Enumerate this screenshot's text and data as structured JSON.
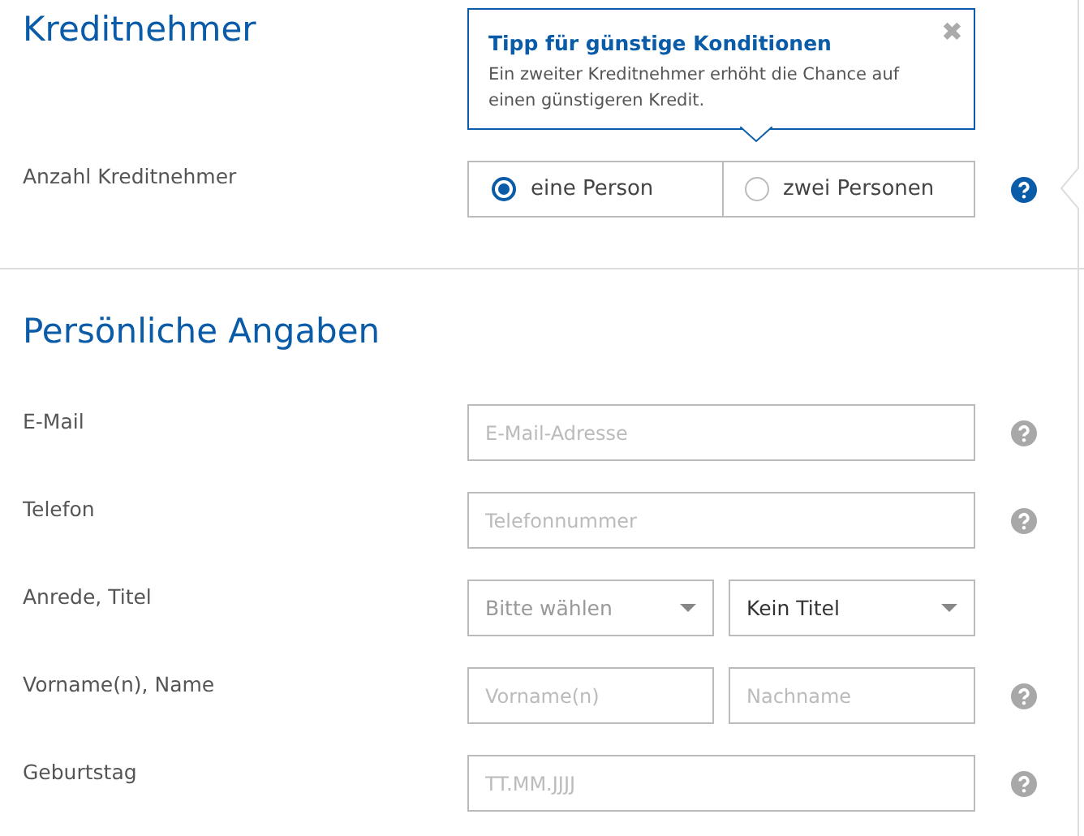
{
  "borrower_section": {
    "title": "Kreditnehmer",
    "tip": {
      "title": "Tipp für günstige Konditionen",
      "text": "Ein zweiter Kreditnehmer erhöht die Chance auf einen günstigeren Kredit.",
      "close": "✖"
    },
    "count_label": "Anzahl Kreditnehmer",
    "options": [
      {
        "label": "eine Person",
        "selected": true
      },
      {
        "label": "zwei Personen",
        "selected": false
      }
    ],
    "help_active": true
  },
  "personal_section": {
    "title": "Persönliche Angaben",
    "rows": [
      {
        "label": "E-Mail",
        "help": true,
        "fields": [
          {
            "kind": "input",
            "placeholder": "E-Mail-Adresse"
          }
        ]
      },
      {
        "label": "Telefon",
        "help": true,
        "fields": [
          {
            "kind": "input",
            "placeholder": "Telefonnummer"
          }
        ]
      },
      {
        "label": "Anrede, Titel",
        "help": false,
        "fields": [
          {
            "kind": "select",
            "placeholder": "Bitte wählen"
          },
          {
            "kind": "select",
            "value": "Kein Titel"
          }
        ]
      },
      {
        "label": "Vorname(n), Name",
        "help": true,
        "fields": [
          {
            "kind": "input",
            "placeholder": "Vorname(n)"
          },
          {
            "kind": "input",
            "placeholder": "Nachname"
          }
        ]
      },
      {
        "label": "Geburtstag",
        "help": true,
        "fields": [
          {
            "kind": "input",
            "placeholder": "TT.MM.JJJJ"
          }
        ]
      }
    ]
  }
}
